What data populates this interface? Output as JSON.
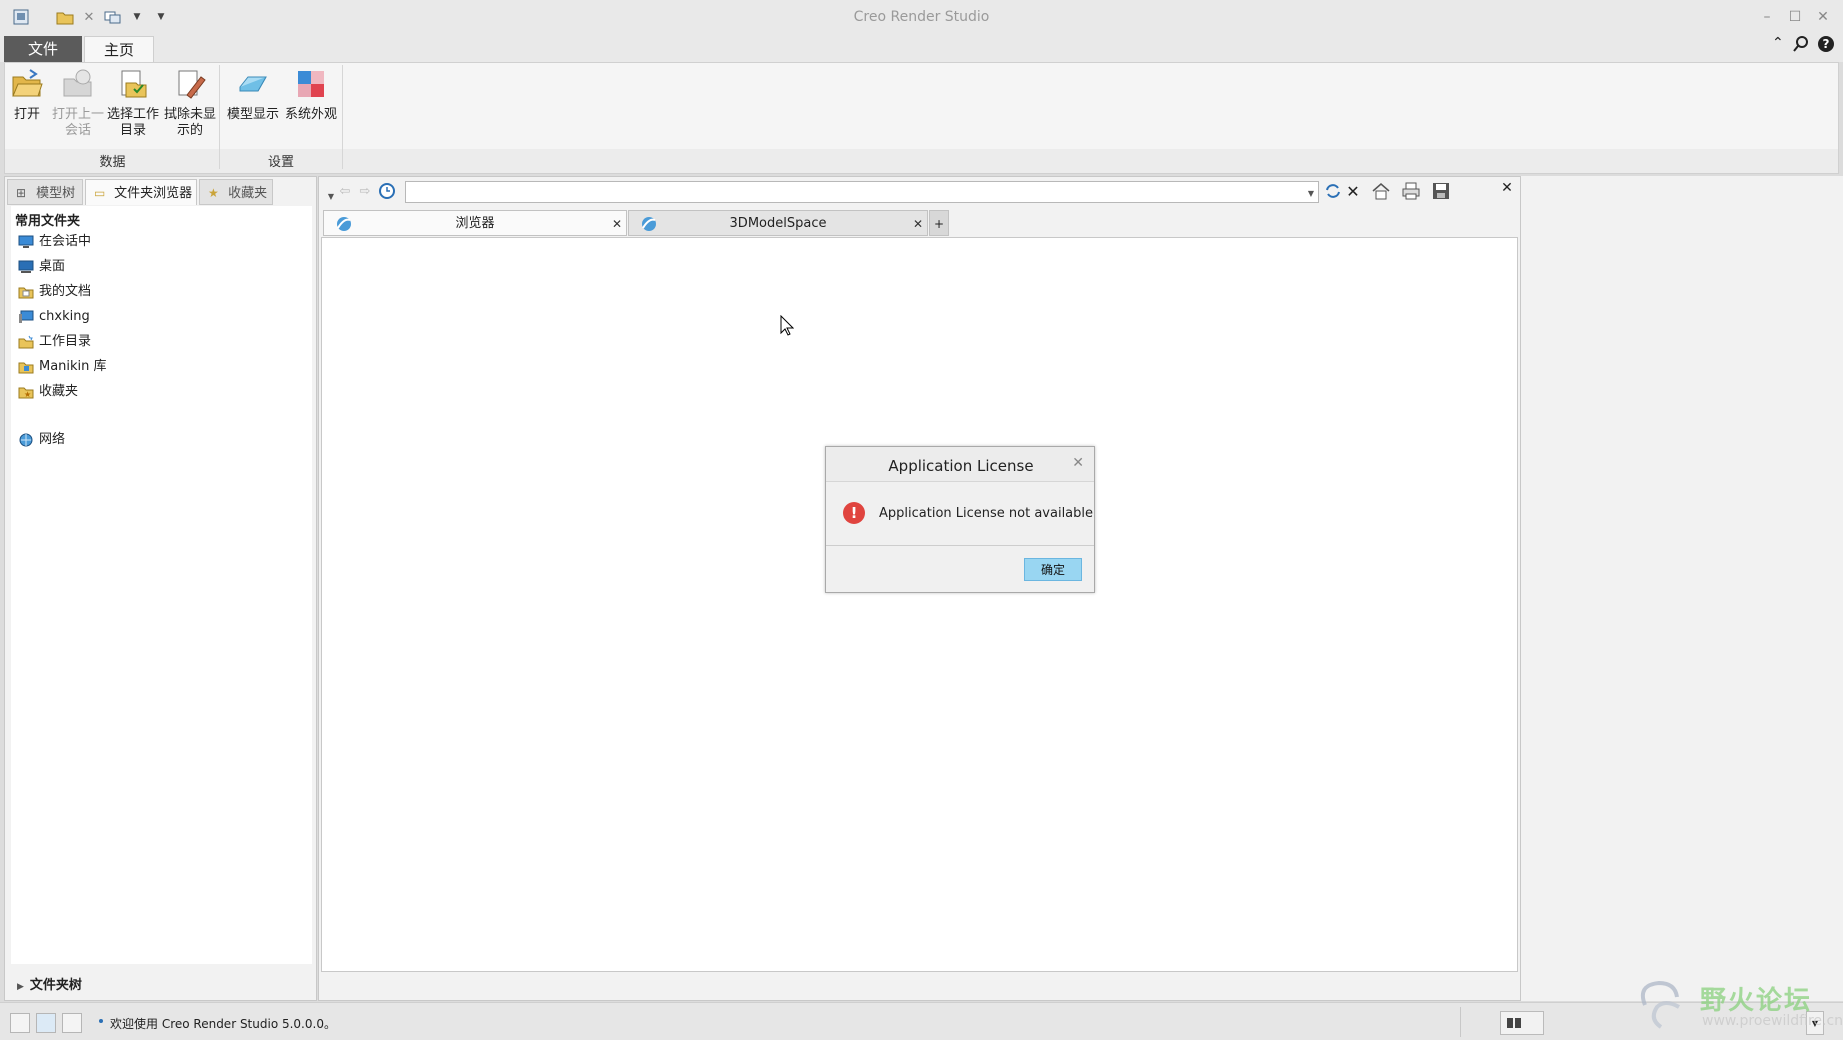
{
  "window": {
    "title": "Creo Render Studio"
  },
  "ribbon_tabs": {
    "file": "文件",
    "home": "主页"
  },
  "ribbon": {
    "open": "打开",
    "open_last_session": [
      "打开上一",
      "会话"
    ],
    "select_working_dir": [
      "选择工作",
      "目录"
    ],
    "erase_not_displayed": [
      "拭除未显",
      "示的"
    ],
    "model_display": "模型显示",
    "system_appearance": "系统外观",
    "group_data": "数据",
    "group_settings": "设置"
  },
  "left_tabs": {
    "model_tree": "模型树",
    "folder_browser": "文件夹浏览器",
    "favorites": "收藏夹"
  },
  "folders": {
    "header": "常用文件夹",
    "items": [
      {
        "label": "在会话中",
        "icon": "monitor-icon"
      },
      {
        "label": "桌面",
        "icon": "desktop-icon"
      },
      {
        "label": "我的文档",
        "icon": "documents-icon"
      },
      {
        "label": "chxking",
        "icon": "computer-icon"
      },
      {
        "label": "工作目录",
        "icon": "working-dir-icon"
      },
      {
        "label": "Manikin 库",
        "icon": "manikin-library-icon"
      },
      {
        "label": "收藏夹",
        "icon": "favorites-icon"
      },
      {
        "label": "网络",
        "icon": "network-icon"
      }
    ],
    "tree_label": "文件夹树"
  },
  "browser": {
    "url_value": "",
    "tabs": [
      {
        "label": "浏览器"
      },
      {
        "label": "3DModelSpace"
      }
    ]
  },
  "status": {
    "message": "欢迎使用 Creo Render Studio 5.0.0.0。"
  },
  "dialog": {
    "title": "Application License",
    "message": "Application License not available",
    "ok": "确定"
  },
  "watermark": {
    "text": "野火论坛",
    "url": "www.proewildfire.cn"
  },
  "colors": {
    "file_tab": "#5b5b5b",
    "ok_button": "#99d6f2",
    "error": "#e0443f",
    "watermark": "#8bd17e"
  }
}
